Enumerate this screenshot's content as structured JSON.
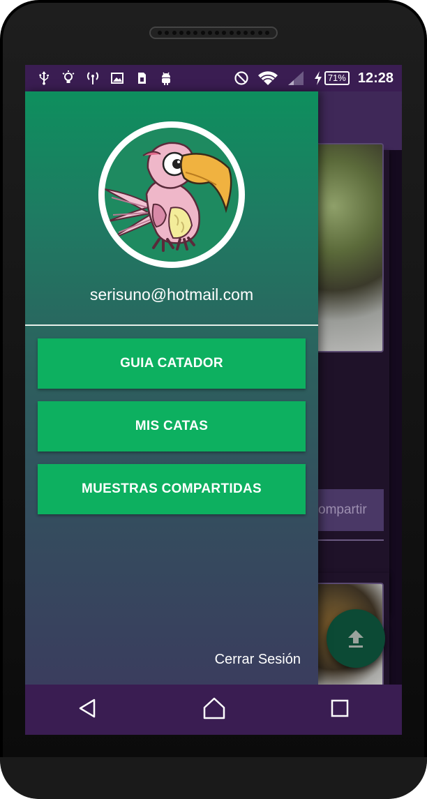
{
  "status_bar": {
    "left_icons": [
      "usb-icon",
      "lightbulb-icon",
      "hotspot-icon",
      "image-icon",
      "sim-card-icon",
      "android-icon"
    ],
    "right_icons": [
      "do-not-disturb-icon",
      "wifi-icon",
      "signal-icon",
      "charging-icon"
    ],
    "battery": "71%",
    "time": "12:28"
  },
  "drawer": {
    "email": "serisuno@hotmail.com",
    "menu": [
      {
        "label": "GUIA CATADOR"
      },
      {
        "label": "MIS CATAS"
      },
      {
        "label": "MUESTRAS COMPARTIDAS"
      }
    ],
    "logout_label": "Cerrar Sesión"
  },
  "content": {
    "share_label": "ompartir"
  },
  "fab_icon": "upload-icon",
  "nav_bar": [
    "back-icon",
    "home-icon",
    "recents-icon"
  ],
  "colors": {
    "status_bar": "#3a1d52",
    "drawer_top": "#0e8f5e",
    "drawer_bottom": "#3a3d5e",
    "menu_button": "#0db060",
    "fab": "#0c4a35"
  }
}
